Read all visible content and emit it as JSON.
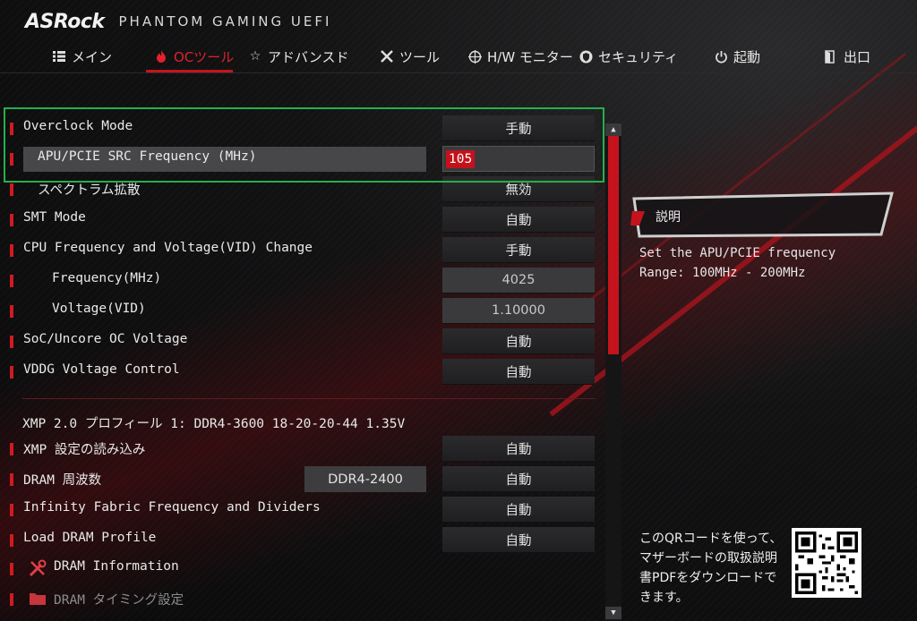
{
  "header": {
    "brand": "ASRock",
    "product": "PHANTOM GAMING UEFI"
  },
  "tabs": [
    {
      "label": "メイン",
      "icon": "list-icon"
    },
    {
      "label": "OCツール",
      "icon": "flame-icon",
      "active": true
    },
    {
      "label": "アドバンスド",
      "icon": "star-icon"
    },
    {
      "label": "ツール",
      "icon": "tools-icon"
    },
    {
      "label": "H/W モニター",
      "icon": "crosshair-icon"
    },
    {
      "label": "セキュリティ",
      "icon": "shield-icon"
    },
    {
      "label": "起動",
      "icon": "power-icon"
    },
    {
      "label": "出口",
      "icon": "exit-door-icon"
    }
  ],
  "settings": [
    {
      "label": "Overclock Mode",
      "value": "手動"
    },
    {
      "label": "APU/PCIE SRC Frequency (MHz)",
      "value": "105"
    },
    {
      "label": "スペクトラム拡散",
      "value": "無効"
    },
    {
      "label": "SMT Mode",
      "value": "自動"
    },
    {
      "label": "CPU Frequency and Voltage(VID) Change",
      "value": "手動"
    },
    {
      "label": "Frequency(MHz)",
      "value": "4025"
    },
    {
      "label": "Voltage(VID)",
      "value": "1.10000"
    },
    {
      "label": "SoC/Uncore OC Voltage",
      "value": "自動"
    },
    {
      "label": "VDDG Voltage Control",
      "value": "自動"
    }
  ],
  "memory": {
    "xmp_title": "XMP 2.0 プロフィール 1: DDR4-3600 18-20-20-44 1.35V",
    "items": [
      {
        "label": "XMP 設定の読み込み",
        "value": "自動"
      },
      {
        "label": "DRAM 周波数",
        "info": "DDR4-2400",
        "value": "自動"
      },
      {
        "label": "Infinity Fabric Frequency and Dividers",
        "value": "自動"
      },
      {
        "label": "Load DRAM Profile",
        "value": "自動"
      }
    ],
    "submenus": [
      {
        "label": "DRAM Information",
        "icon": "wrench-screwdriver-icon"
      },
      {
        "label": "DRAM タイミング設定",
        "icon": "folder-icon"
      }
    ]
  },
  "description": {
    "title": "説明",
    "lines": [
      "Set the APU/PCIE frequency",
      "Range: 100MHz - 200MHz"
    ]
  },
  "qr": {
    "text": "このQRコードを使って、マザーボードの取扱説明書PDFをダウンロードできます。"
  },
  "colors": {
    "accent": "#c5131d",
    "highlight_box": "#24b04a"
  }
}
